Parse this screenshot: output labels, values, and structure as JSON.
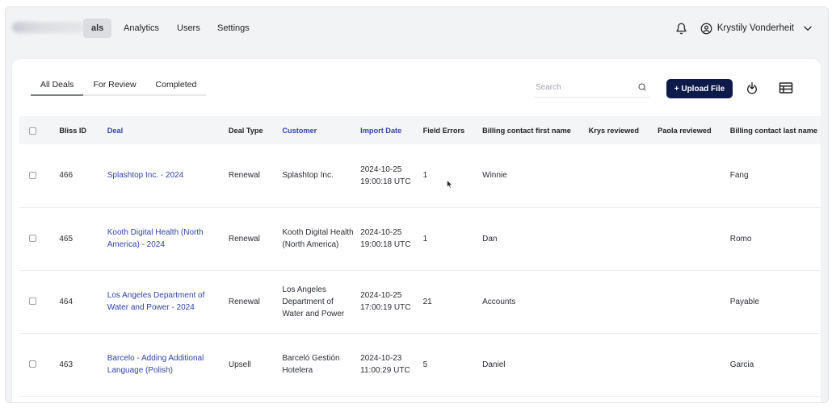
{
  "nav": {
    "tabs": [
      {
        "label": "als",
        "active": true
      },
      {
        "label": "Analytics",
        "active": false
      },
      {
        "label": "Users",
        "active": false
      },
      {
        "label": "Settings",
        "active": false
      }
    ],
    "user_name": "Krystily Vonderheit"
  },
  "subtabs": [
    {
      "label": "All Deals",
      "active": true
    },
    {
      "label": "For Review",
      "active": false
    },
    {
      "label": "Completed",
      "active": false
    }
  ],
  "search": {
    "placeholder": "Search"
  },
  "upload_label": "+ Upload File",
  "table": {
    "columns": [
      "Bliss ID",
      "Deal",
      "Deal Type",
      "Customer",
      "Import Date",
      "Field Errors",
      "Billing contact first name",
      "Krys reviewed",
      "Paola reviewed",
      "Billing contact last name"
    ],
    "rows": [
      {
        "id": "466",
        "deal": "Splashtop Inc. - 2024",
        "type": "Renewal",
        "customer": "Splashtop Inc.",
        "date": "2024-10-25 19:00:18 UTC",
        "errors": "1",
        "first": "Winnie",
        "krys": "",
        "paola": "",
        "last": "Fang"
      },
      {
        "id": "465",
        "deal": "Kooth Digital Health (North America) - 2024",
        "type": "Renewal",
        "customer": "Kooth Digital Health (North America)",
        "date": "2024-10-25 19:00:18 UTC",
        "errors": "1",
        "first": "Dan",
        "krys": "",
        "paola": "",
        "last": "Romo"
      },
      {
        "id": "464",
        "deal": "Los Angeles Department of Water and Power - 2024",
        "type": "Renewal",
        "customer": "Los Angeles Department of Water and Power",
        "date": "2024-10-25 17:00:19 UTC",
        "errors": "21",
        "first": "Accounts",
        "krys": "",
        "paola": "",
        "last": "Payable"
      },
      {
        "id": "463",
        "deal": "Barcelo - Adding Additional Language (Polish)",
        "type": "Upsell",
        "customer": "Barceló Gestión Hotelera",
        "date": "2024-10-23 11:00:29 UTC",
        "errors": "5",
        "first": "Daniel",
        "krys": "",
        "paola": "",
        "last": "Garcia"
      }
    ]
  },
  "icons": {
    "bell": "bell-icon",
    "user": "user-circle-icon",
    "chevron": "chevron-down-icon",
    "search": "search-icon",
    "export": "export-icon",
    "columns": "table-columns-icon"
  },
  "colors": {
    "accent": "#0d1a4a",
    "link": "#2f44a6"
  }
}
